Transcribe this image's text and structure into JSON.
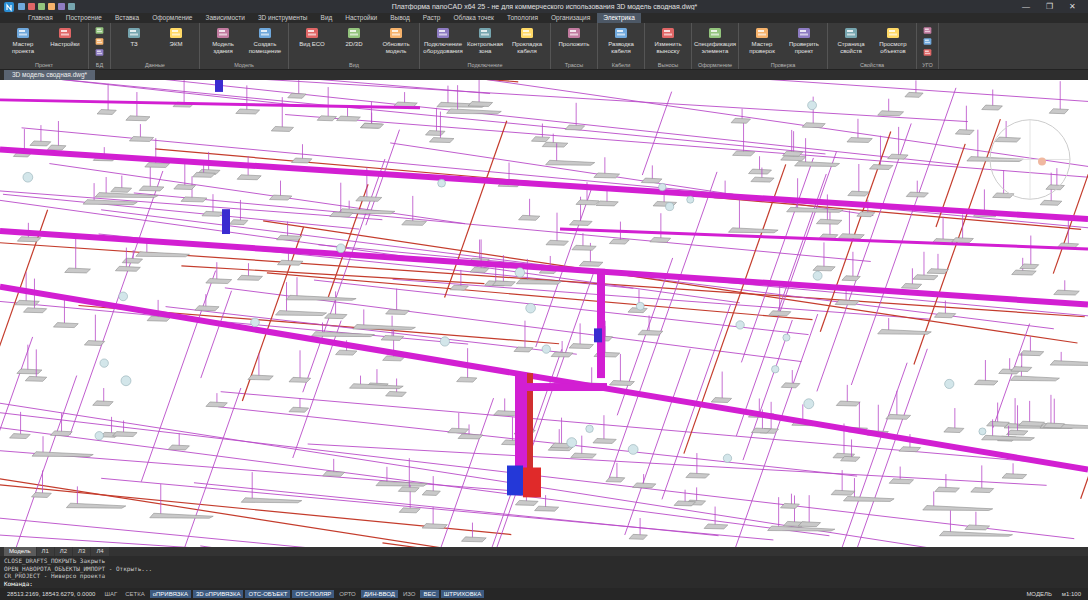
{
  "window": {
    "title": "Платформа nanoCAD x64 25 - не для коммерческого использования 3D модель сводная.dwg*",
    "controls": [
      "—",
      "❐",
      "✕"
    ]
  },
  "ribbon_tabs": [
    {
      "label": "Главная",
      "selected": false
    },
    {
      "label": "Построение",
      "selected": false
    },
    {
      "label": "Вставка",
      "selected": false
    },
    {
      "label": "Оформление",
      "selected": false
    },
    {
      "label": "Зависимости",
      "selected": false
    },
    {
      "label": "3D инструменты",
      "selected": false
    },
    {
      "label": "Вид",
      "selected": false
    },
    {
      "label": "Настройки",
      "selected": false
    },
    {
      "label": "Вывод",
      "selected": false
    },
    {
      "label": "Растр",
      "selected": false
    },
    {
      "label": "Облака точек",
      "selected": false
    },
    {
      "label": "Топология",
      "selected": false
    },
    {
      "label": "Организация",
      "selected": false
    },
    {
      "label": "Электрика",
      "selected": true
    }
  ],
  "ribbon_groups": [
    {
      "label": "Проект",
      "buttons": [
        "Мастер проекта",
        "Настройки"
      ]
    },
    {
      "label": "БД",
      "buttons": []
    },
    {
      "label": "Данные",
      "buttons": [
        "ТЗ",
        "ЭКМ"
      ]
    },
    {
      "label": "Модель",
      "buttons": [
        "Модель здания",
        "Создать помещение"
      ]
    },
    {
      "label": "Вид",
      "buttons": [
        "Вид ЕСО",
        "2D/3D",
        "Обновить модель"
      ]
    },
    {
      "label": "Подключение",
      "buttons": [
        "Подключение оборудования",
        "Контрольная зона",
        "Прокладка кабеля"
      ]
    },
    {
      "label": "Трассы",
      "buttons": [
        "Проложить"
      ]
    },
    {
      "label": "Кабели",
      "buttons": [
        "Разводка кабеля"
      ]
    },
    {
      "label": "Выносы",
      "buttons": [
        "Изменить выноску"
      ]
    },
    {
      "label": "Оформление",
      "buttons": [
        "Спецификация элемента"
      ]
    },
    {
      "label": "Проверка",
      "buttons": [
        "Мастер проверок",
        "Проверить проект"
      ]
    },
    {
      "label": "Свойства",
      "buttons": [
        "Страница свойств",
        "Просмотр объектов"
      ]
    },
    {
      "label": "УГО",
      "buttons": []
    }
  ],
  "document_tabs": [
    {
      "label": "3D модель сводная.dwg*",
      "selected": true
    }
  ],
  "layout_tabs": [
    {
      "label": "Модель",
      "selected": true
    },
    {
      "label": "Л1",
      "selected": false
    },
    {
      "label": "Л2",
      "selected": false
    },
    {
      "label": "Л3",
      "selected": false
    },
    {
      "label": "Л4",
      "selected": false
    }
  ],
  "command_line": [
    "CLOSE_DRAFTS_ПОКРЫТЬ    Закрыть",
    "OPEN_НАВОРОТА_ОБЪЕКТЫ_ИМПОРТ - Открыть...",
    "CR_PROJECT - Ниверсо проекта"
  ],
  "command_prompt": "Команда:",
  "status_bar": {
    "coordinates": "28513.2169, 18543.6279, 0.0000",
    "toggles": [
      {
        "label": "ШАГ",
        "on": false
      },
      {
        "label": "СЕТКА",
        "on": false
      },
      {
        "label": "оПРИВЯЗКА",
        "on": true
      },
      {
        "label": "3D оПРИВЯЗКА",
        "on": true
      },
      {
        "label": "ОТС-ОБЪЕКТ",
        "on": true
      },
      {
        "label": "ОТС-ПОЛЯР",
        "on": true
      },
      {
        "label": "ОРТО",
        "on": false
      },
      {
        "label": "ДИН-ВВОД",
        "on": true
      },
      {
        "label": "ИЗО",
        "on": false
      },
      {
        "label": "ВЕС",
        "on": true
      },
      {
        "label": "ШТРИХОВКА",
        "on": true
      }
    ],
    "right": [
      "МОДЕЛЬ",
      "м1:100"
    ]
  }
}
